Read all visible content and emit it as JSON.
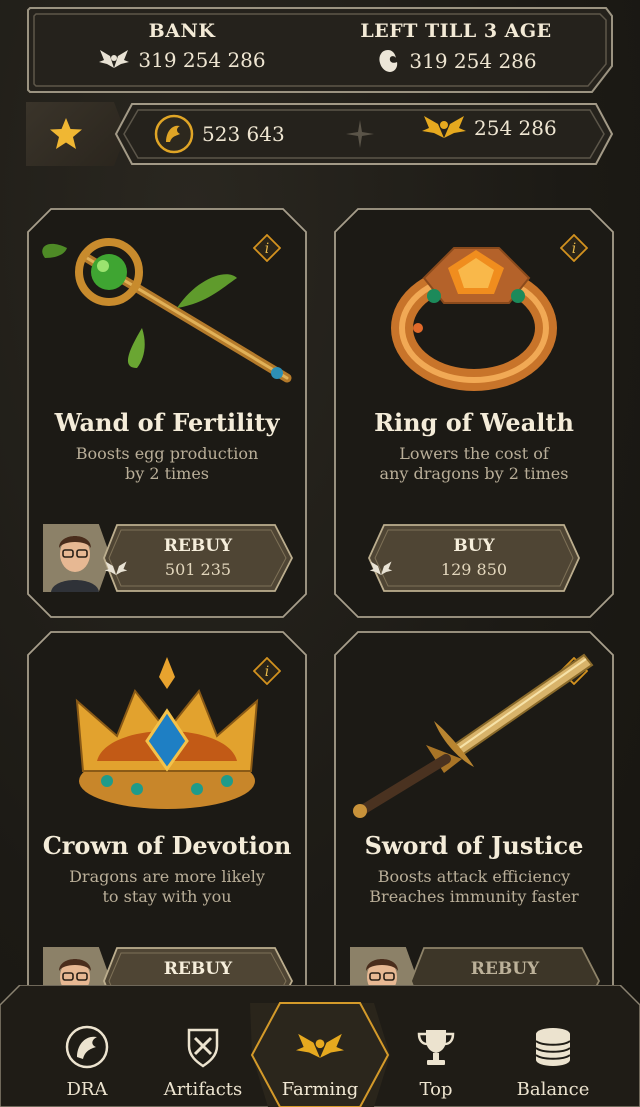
{
  "header": {
    "bank_label": "BANK",
    "bank_value": "319 254 286",
    "left_label": "LEFT TILL 3 AGE",
    "left_value": "319 254 286"
  },
  "currencies": {
    "gold_coin_value": "523 643",
    "wing_value": "254 286"
  },
  "cards": [
    {
      "title": "Wand of Fertility",
      "desc_line1": "Boosts egg production",
      "desc_line2": "by 2 times",
      "button_label": "REBUY",
      "price": "501 235",
      "icon": "wand-icon"
    },
    {
      "title": "Ring of Wealth",
      "desc_line1": "Lowers the cost of",
      "desc_line2": "any dragons by 2 times",
      "button_label": "BUY",
      "price": "129 850",
      "icon": "ring-icon"
    },
    {
      "title": "Crown of Devotion",
      "desc_line1": "Dragons are more likely",
      "desc_line2": "to stay with you",
      "button_label": "REBUY",
      "price": "",
      "icon": "crown-icon"
    },
    {
      "title": "Sword of Justice",
      "desc_line1": "Boosts attack efficiency",
      "desc_line2": "Breaches immunity faster",
      "button_label": "REBUY",
      "price": "",
      "icon": "sword-icon"
    }
  ],
  "nav": [
    {
      "label": "DRA",
      "icon": "dragon-head-icon"
    },
    {
      "label": "Artifacts",
      "icon": "shield-icon"
    },
    {
      "label": "Farming",
      "icon": "golden-dragon-icon",
      "active": true
    },
    {
      "label": "Top",
      "icon": "trophy-icon"
    },
    {
      "label": "Balance",
      "icon": "coins-stack-icon"
    }
  ],
  "colors": {
    "accent_gold": "#e0a526",
    "frame": "#a69d8a",
    "background": "#1f1d18"
  }
}
